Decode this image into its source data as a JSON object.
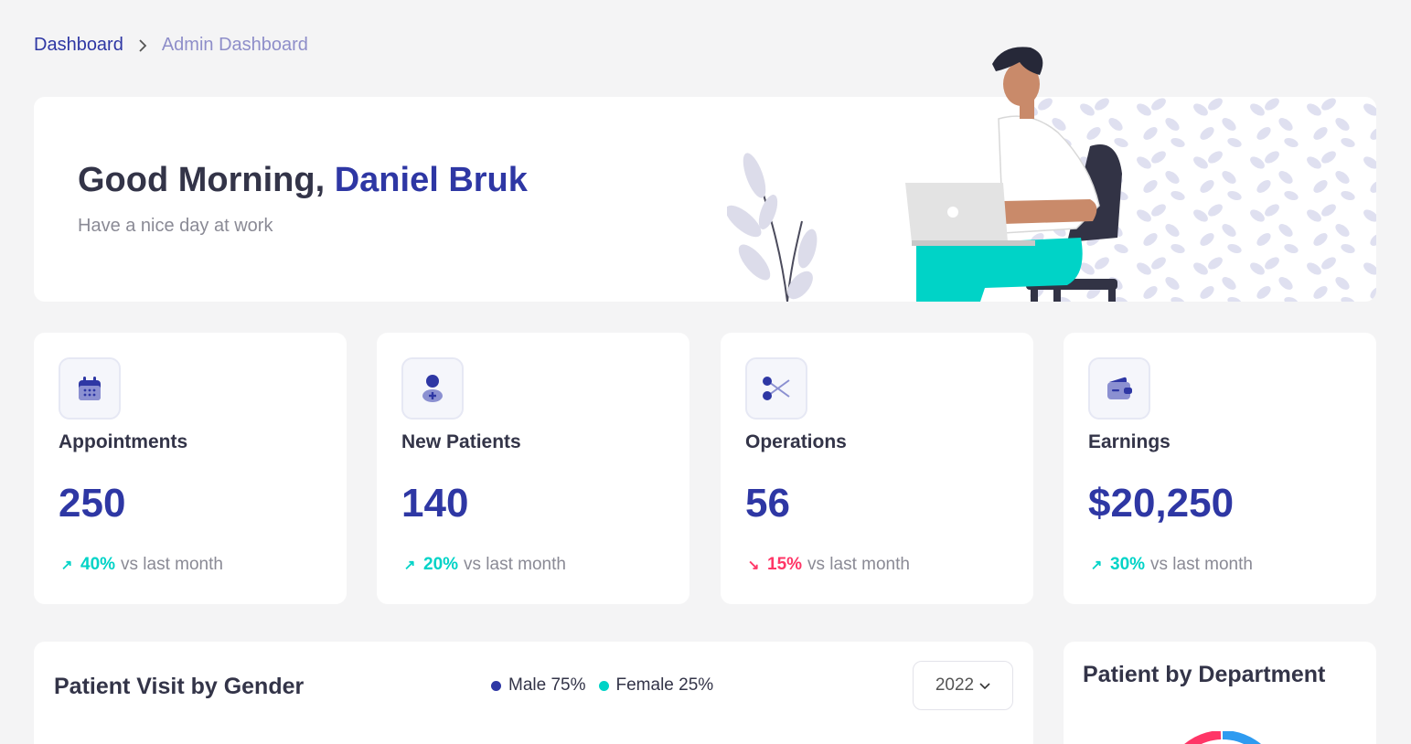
{
  "breadcrumb": {
    "root": "Dashboard",
    "current": "Admin Dashboard"
  },
  "welcome": {
    "greeting": "Good Morning,",
    "name": "Daniel Bruk",
    "subtitle": "Have a nice day at work"
  },
  "stats": [
    {
      "label": "Appointments",
      "value": "250",
      "trend": "up",
      "pct": "40%",
      "suffix": "vs last month",
      "icon": "calendar-icon"
    },
    {
      "label": "New Patients",
      "value": "140",
      "trend": "up",
      "pct": "20%",
      "suffix": "vs last month",
      "icon": "patient-icon"
    },
    {
      "label": "Operations",
      "value": "56",
      "trend": "down",
      "pct": "15%",
      "suffix": "vs last month",
      "icon": "scissors-icon"
    },
    {
      "label": "Earnings",
      "value": "$20,250",
      "trend": "up",
      "pct": "30%",
      "suffix": "vs last month",
      "icon": "wallet-icon"
    }
  ],
  "gender_panel": {
    "title": "Patient Visit by Gender",
    "legend": [
      {
        "label": "Male 75%",
        "color": "#2e37a4"
      },
      {
        "label": "Female 25%",
        "color": "#00d3c7"
      }
    ],
    "year": "2022"
  },
  "dept_panel": {
    "title": "Patient by Department"
  },
  "colors": {
    "primary": "#2e37a4",
    "teal": "#00d3c7",
    "red": "#ff3667"
  }
}
